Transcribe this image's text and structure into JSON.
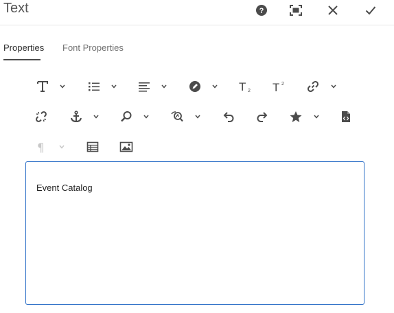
{
  "window": {
    "title": "Text"
  },
  "header_actions": [
    {
      "name": "help-icon"
    },
    {
      "name": "fullscreen-icon"
    },
    {
      "name": "close-icon"
    },
    {
      "name": "check-icon"
    }
  ],
  "tabs": [
    {
      "label": "Properties",
      "active": true
    },
    {
      "label": "Font Properties",
      "active": false
    }
  ],
  "toolbar": {
    "row1": [
      "text-format-icon",
      "list-icon",
      "paragraph-align-icon",
      "color-fill-icon",
      "subscript-icon",
      "superscript-icon",
      "link-icon"
    ],
    "row2": [
      "unlink-icon",
      "anchor-icon",
      "find-icon",
      "find-replace-icon",
      "undo-icon",
      "redo-icon",
      "special-character-icon",
      "source-edit-icon"
    ],
    "row3": [
      "paragraph-format-icon",
      "table-icon",
      "image-icon"
    ],
    "subscript_glyph": "T",
    "subscript_mark": "2",
    "superscript_glyph": "T",
    "superscript_mark": "2",
    "paragraph_glyph": "¶"
  },
  "editor": {
    "content": "Event Catalog"
  },
  "colors": {
    "accent": "#2d6fc7",
    "icon": "#4b4b4b",
    "disabled": "#c8c8c8",
    "divider": "#e6e6e6"
  }
}
